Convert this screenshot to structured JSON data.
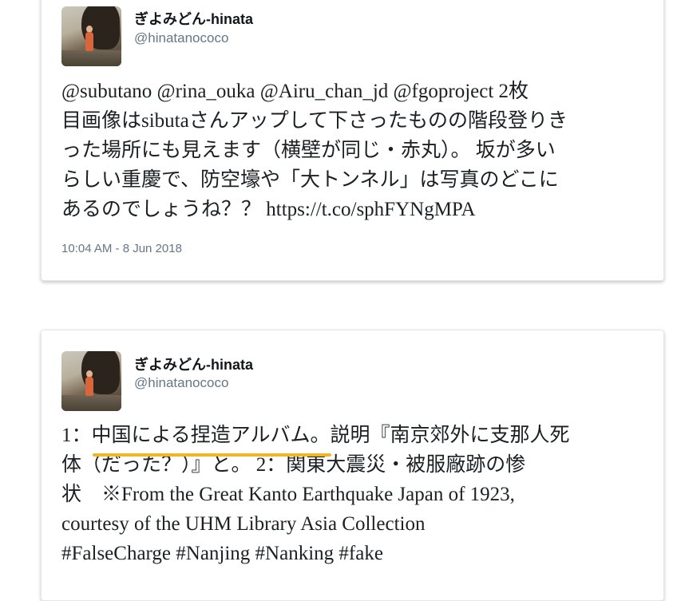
{
  "tweets": [
    {
      "author_name": "ぎよみどん-hinata",
      "author_handle": "@hinatanococo",
      "lines": [
        "@subutano @rina_ouka @Airu_chan_jd @fgoproject 2枚",
        "目画像はsibutaさんアップして下さったものの階段登りき",
        "った場所にも見えます（横壁が同じ・赤丸）。 坂が多い",
        "らしい重慶で、防空壕や「大トンネル」は写真のどこに",
        "あるのでしょうね？？ https://t.co/sphFYNgMPA"
      ],
      "timestamp": "10:04 AM - 8 Jun 2018"
    },
    {
      "author_name": "ぎよみどん-hinata",
      "author_handle": "@hinatanococo",
      "lines": [
        "1：中国による捏造アルバム。説明『南京郊外に支那人死",
        "体（だった？）』と。 2：関東大震災・被服廠跡の惨",
        "状　※From the Great Kanto Earthquake Japan of 1923,",
        "courtesy of the UHM Library Asia Collection",
        "#FalseCharge #Nanjing #Nanking #fake"
      ]
    }
  ],
  "colors": {
    "highlight_underline": "#f2b526",
    "handle_gray": "#657786",
    "text_dark": "#1c2022"
  }
}
